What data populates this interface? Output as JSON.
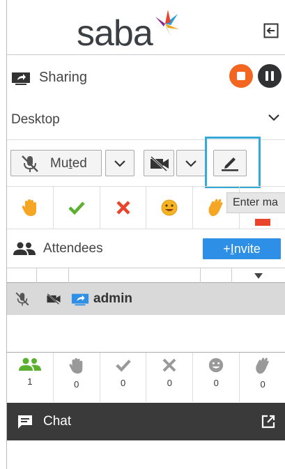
{
  "header": {
    "logo_text": "saba",
    "exit_icon": "exit-icon"
  },
  "sharing": {
    "label": "Sharing",
    "source_value": "Desktop",
    "colors": {
      "stop": "#f26622",
      "pause": "#2f3133"
    }
  },
  "controls": {
    "muted_label_pre": "Mu",
    "muted_label_t": "t",
    "muted_label_post": "ed",
    "tooltip": "Enter ma"
  },
  "reactions": [
    "raise-hand",
    "yes",
    "no",
    "smile",
    "applause",
    "more"
  ],
  "attendees": {
    "label": "Attendees",
    "invite_prefix": "+",
    "invite_label_u": "I",
    "invite_label_rest": "nvite",
    "rows": [
      {
        "name": "admin"
      }
    ]
  },
  "counts": [
    {
      "icon": "attendees-icon",
      "value": "1"
    },
    {
      "icon": "raise-hand-icon",
      "value": "0"
    },
    {
      "icon": "check-icon",
      "value": "0"
    },
    {
      "icon": "x-icon",
      "value": "0"
    },
    {
      "icon": "smile-icon",
      "value": "0"
    },
    {
      "icon": "applause-icon",
      "value": "0"
    }
  ],
  "chat": {
    "label": "Chat"
  },
  "colors": {
    "accent_blue": "#2d8fe5",
    "highlight": "#35a9d8",
    "green": "#5bb030",
    "red": "#e8452c"
  }
}
